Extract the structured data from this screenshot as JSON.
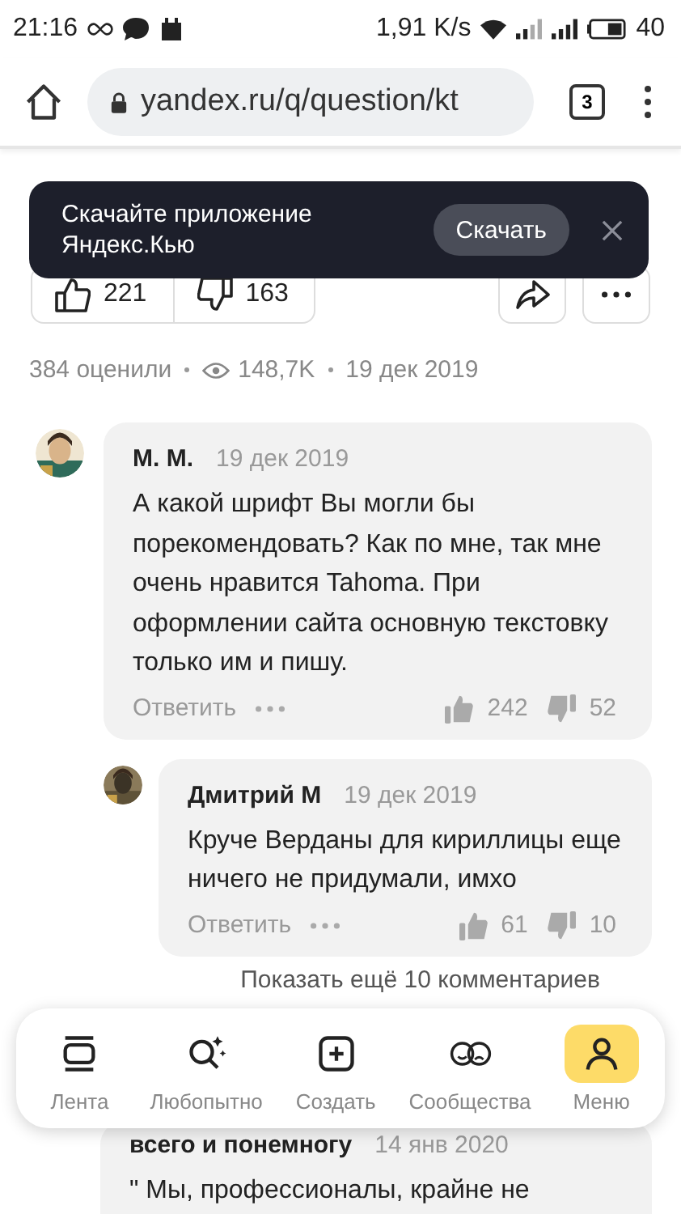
{
  "status_bar": {
    "time": "21:16",
    "speed": "1,91 K/s",
    "battery": "40"
  },
  "browser": {
    "url": "yandex.ru/q/question/kt",
    "tab_count": "3"
  },
  "banner": {
    "text": "Скачайте приложение Яндекс.Кью",
    "button": "Скачать"
  },
  "answer_actions": {
    "likes": "221",
    "dislikes": "163"
  },
  "meta": {
    "ratings": "384 оценили",
    "views": "148,7K",
    "date": "19 дек 2019"
  },
  "comments": [
    {
      "author": "М. М.",
      "date": "19 дек 2019",
      "text": "А какой шрифт Вы могли бы порекомендовать? Как по мне, так мне очень нравится Tahoma. При оформлении сайта основную текстовку только им и пишу.",
      "reply": "Ответить",
      "likes": "242",
      "dislikes": "52",
      "children": [
        {
          "author": "Дмитрий М",
          "date": "19 дек 2019",
          "text": "Круче Верданы для кириллицы еще ничего не придумали, имхо",
          "reply": "Ответить",
          "likes": "61",
          "dislikes": "10"
        }
      ]
    }
  ],
  "show_more": "Показать ещё 10 комментариев",
  "next_comment": {
    "author": "всего и понемногу",
    "date": "14 янв 2020",
    "text": "\" Мы, профессионалы, крайне не"
  },
  "nav": [
    {
      "label": "Лента",
      "selected": false
    },
    {
      "label": "Любопытно",
      "selected": false
    },
    {
      "label": "Создать",
      "selected": false
    },
    {
      "label": "Сообщества",
      "selected": false
    },
    {
      "label": "Меню",
      "selected": true
    }
  ]
}
